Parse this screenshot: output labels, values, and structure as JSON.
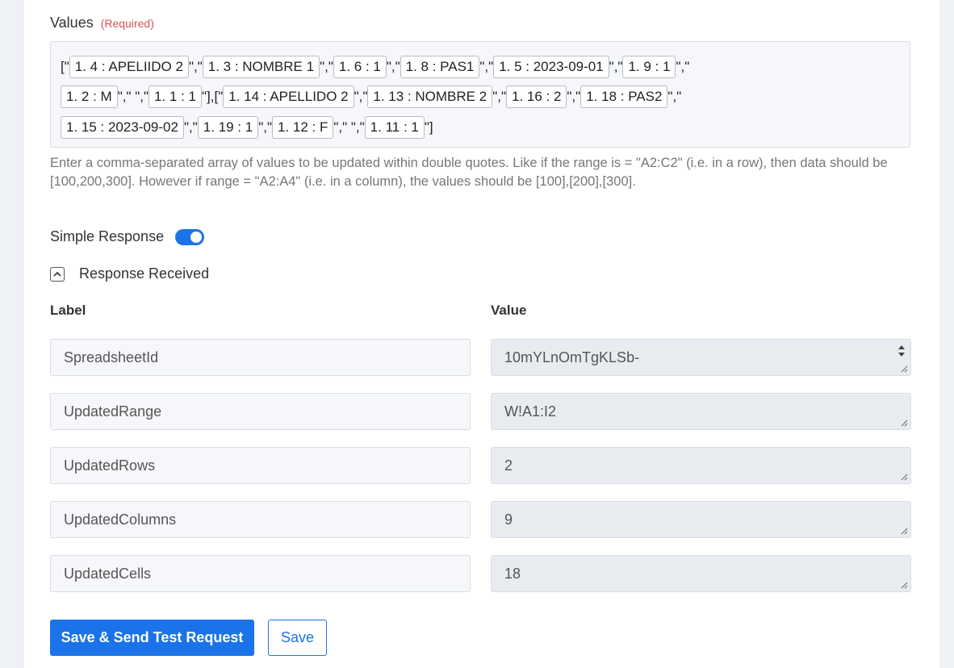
{
  "form": {
    "values_label": "Values",
    "required_text": "(Required)",
    "values_lines": [
      [
        {
          "t": "[\""
        },
        {
          "c": "1. 4 : APELIIDO 2"
        },
        {
          "t": "\",\""
        },
        {
          "c": "1. 3 : NOMBRE 1"
        },
        {
          "t": "\",\""
        },
        {
          "c": "1. 6 : 1"
        },
        {
          "t": "\",\""
        },
        {
          "c": "1. 8 : PAS1"
        },
        {
          "t": "\",\""
        },
        {
          "c": "1. 5 : 2023-09-01"
        },
        {
          "t": "\",\""
        },
        {
          "c": "1. 9 : 1"
        },
        {
          "t": "\",\""
        }
      ],
      [
        {
          "c": "1. 2 : M"
        },
        {
          "t": "\",\" \",\""
        },
        {
          "c": "1. 1 : 1"
        },
        {
          "t": "\"],[\""
        },
        {
          "c": "1. 14 : APELLIDO 2"
        },
        {
          "t": "\",\""
        },
        {
          "c": "1. 13 : NOMBRE 2"
        },
        {
          "t": "\",\""
        },
        {
          "c": "1. 16 : 2"
        },
        {
          "t": "\",\""
        },
        {
          "c": "1. 18 : PAS2"
        },
        {
          "t": "\",\""
        }
      ],
      [
        {
          "c": "1. 15 : 2023-09-02"
        },
        {
          "t": "\",\""
        },
        {
          "c": "1. 19 : 1"
        },
        {
          "t": "\",\""
        },
        {
          "c": "1. 12 : F"
        },
        {
          "t": "\",\" \",\""
        },
        {
          "c": "1. 11 : 1"
        },
        {
          "t": "\"]"
        }
      ]
    ],
    "help_text": "Enter a comma-separated array of values to be updated within double quotes. Like if the range is = \"A2:C2\" (i.e. in a row), then data should be [100,200,300]. However if range = \"A2:A4\" (i.e. in a column), the values should be [100],[200],[300].",
    "simple_response_label": "Simple Response",
    "simple_response_on": true,
    "response_received_label": "Response Received"
  },
  "response_table": {
    "label_header": "Label",
    "value_header": "Value",
    "rows": [
      {
        "label": "SpreadsheetId",
        "value": "10mYLnOmTgKLSb-"
      },
      {
        "label": "UpdatedRange",
        "value": "W!A1:I2"
      },
      {
        "label": "UpdatedRows",
        "value": "2"
      },
      {
        "label": "UpdatedColumns",
        "value": "9"
      },
      {
        "label": "UpdatedCells",
        "value": "18"
      }
    ]
  },
  "buttons": {
    "save_send_label": "Save & Send Test Request",
    "save_label": "Save"
  },
  "colors": {
    "accent": "#1a73e8",
    "required": "#d9534f"
  }
}
